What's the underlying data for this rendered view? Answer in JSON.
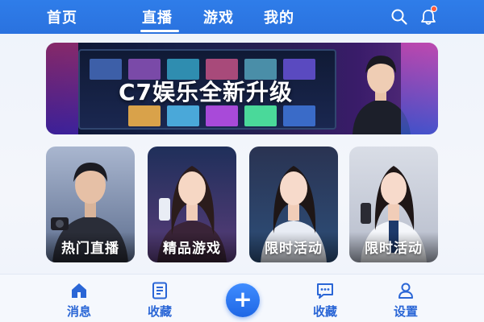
{
  "top_nav": {
    "tabs": [
      {
        "label": "首页"
      },
      {
        "label": "直播"
      },
      {
        "label": "游戏"
      },
      {
        "label": "我的"
      }
    ],
    "active_tab": "直播",
    "icons": [
      "search-icon",
      "bell-icon"
    ],
    "colors": {
      "bar": "#2f7de9",
      "notification_dot": "#ff5b3a"
    }
  },
  "banner": {
    "title": "C7娱乐全新升级"
  },
  "cards": [
    {
      "label": "热门直播"
    },
    {
      "label": "精品游戏"
    },
    {
      "label": "限时活动"
    },
    {
      "label": "限时活动"
    }
  ],
  "bottom_nav": {
    "tabs": [
      {
        "label": "消息",
        "icon": "home-icon"
      },
      {
        "label": "收藏",
        "icon": "document-icon"
      },
      {
        "label": "收藏",
        "icon": "chat-icon"
      },
      {
        "label": "设置",
        "icon": "user-icon"
      }
    ],
    "center_button": {
      "symbol": "+",
      "icon": "plus-icon"
    },
    "colors": {
      "accent": "#2a66d6"
    }
  }
}
